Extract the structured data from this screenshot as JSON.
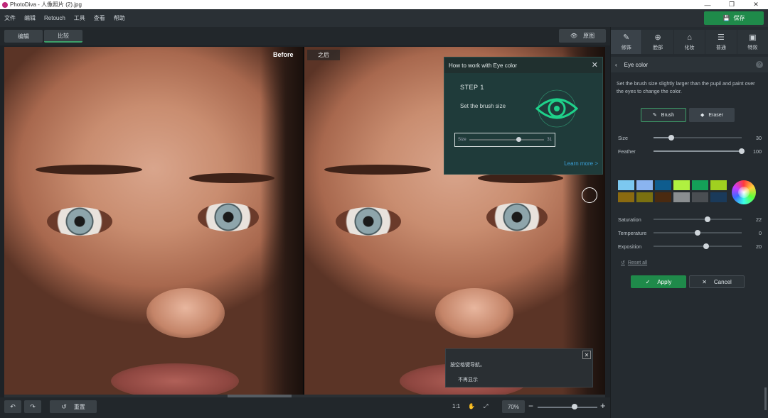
{
  "window": {
    "title": "PhotoDiva - 人像照片 (2).jpg"
  },
  "menu": [
    "文件",
    "编辑",
    "Retouch",
    "工具",
    "查看",
    "帮助"
  ],
  "save_label": "保存",
  "view_tabs": {
    "edit": "编辑",
    "compare": "比较"
  },
  "original_label": "原图",
  "before_label": "Before",
  "after_label": "之后",
  "tip": {
    "title": "How to work with Eye color",
    "step": "STEP 1",
    "text": "Set the brush size",
    "slider_label": "Size",
    "slider_value": "31",
    "slider_level": 0.63,
    "link": "Learn more >"
  },
  "toast": {
    "text": "按空格键导航。",
    "checkbox": "不再显示"
  },
  "bottom": {
    "reset_label": "重置",
    "ratio": "1:1",
    "zoom": "70%",
    "minus": "−",
    "plus": "+",
    "zoom_level": 0.62
  },
  "tabs": [
    {
      "label": "修饰",
      "icon": "face-retouch-icon"
    },
    {
      "label": "脸部",
      "icon": "face-icon"
    },
    {
      "label": "化妆",
      "icon": "makeup-icon"
    },
    {
      "label": "普通",
      "icon": "sliders-icon"
    },
    {
      "label": "特效",
      "icon": "effects-icon"
    }
  ],
  "panel": {
    "title": "Eye color",
    "description": "Set the brush size slightly larger than the pupil and paint over the eyes to change the color.",
    "brush_label": "Brush",
    "eraser_label": "Eraser",
    "sliders": [
      {
        "label": "Size",
        "value": "30",
        "level": 0.2
      },
      {
        "label": "Feather",
        "value": "100",
        "level": 1.0
      }
    ],
    "sliders2": [
      {
        "label": "Saturation",
        "value": "22",
        "level": 0.61
      },
      {
        "label": "Temperature",
        "value": "0",
        "level": 0.5
      },
      {
        "label": "Exposition",
        "value": "20",
        "level": 0.6
      }
    ],
    "swatches": [
      "#7cc8f0",
      "#8ab4f0",
      "#0e5c8e",
      "#b0f040",
      "#14a058",
      "#a0d020",
      "#8a6a10",
      "#7a7010",
      "#4a2a10",
      "#8a8e90",
      "#4a4e52",
      "#1a3a5a"
    ],
    "reset_label": "Reset all",
    "apply_label": "Apply",
    "cancel_label": "Cancel"
  }
}
